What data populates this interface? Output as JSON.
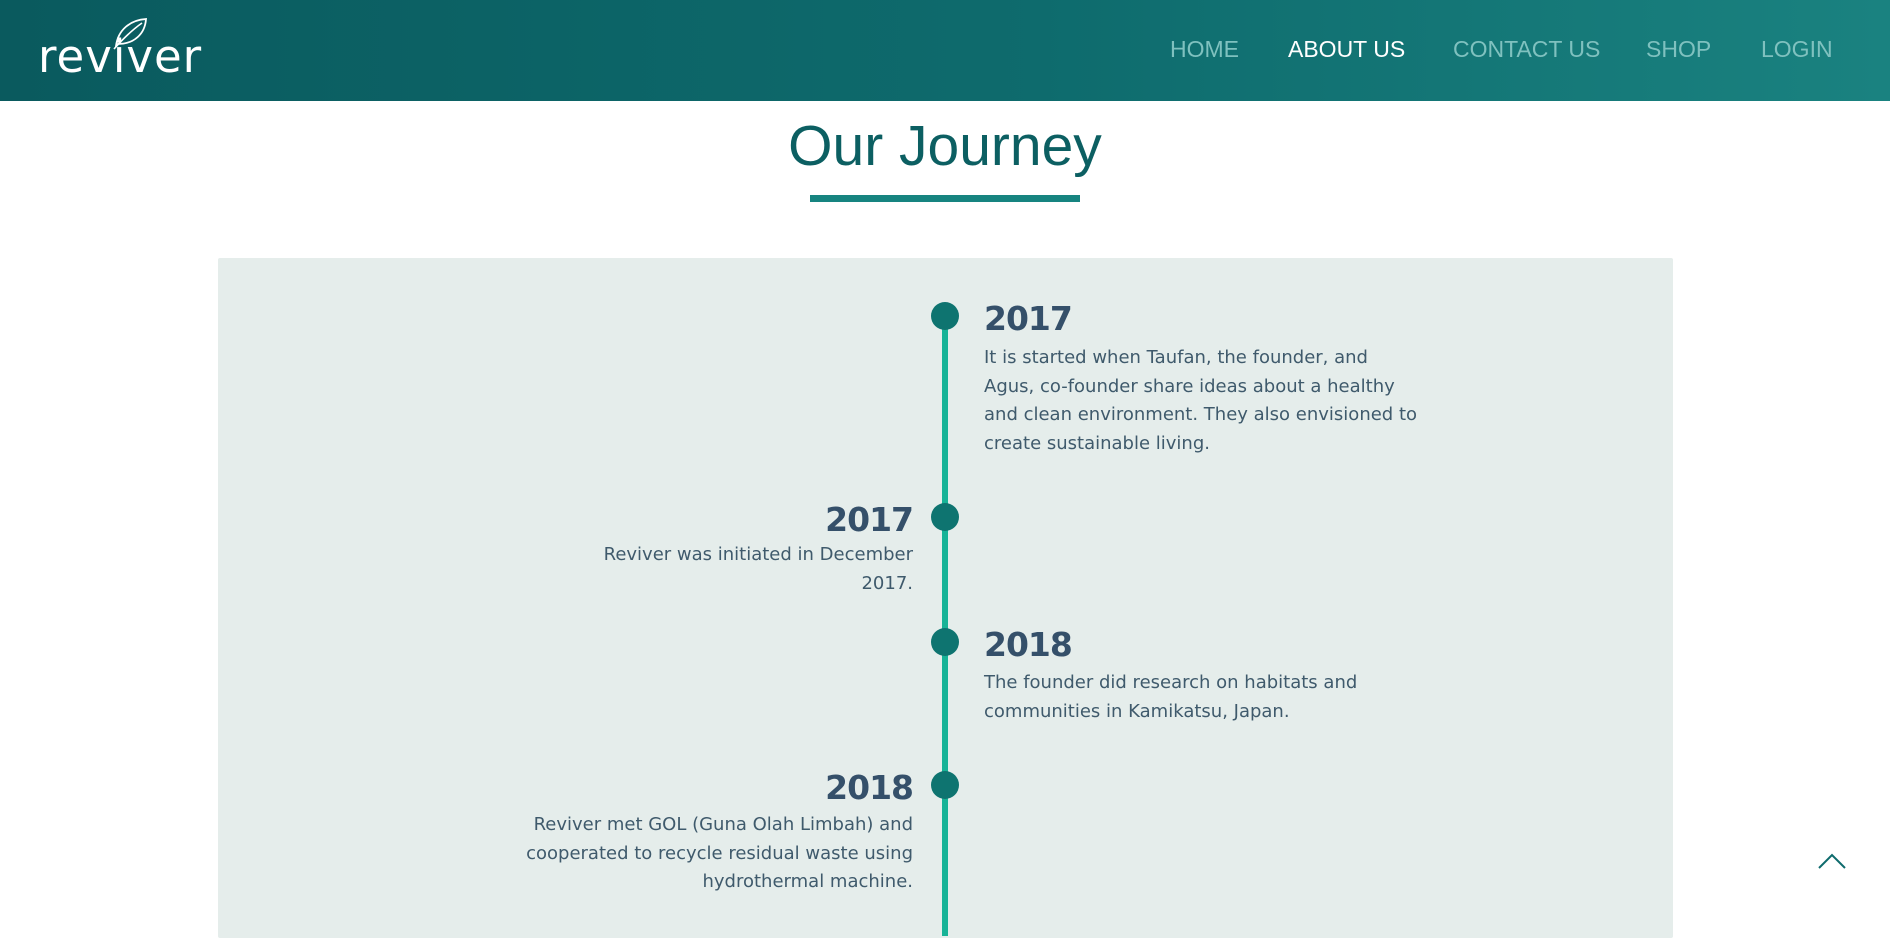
{
  "header": {
    "logo_text": "reviver",
    "nav": [
      {
        "label": "HOME",
        "active": false
      },
      {
        "label": "ABOUT US",
        "active": true
      },
      {
        "label": "CONTACT US",
        "active": false
      },
      {
        "label": "SHOP",
        "active": false
      },
      {
        "label": "LOGIN",
        "active": false
      }
    ]
  },
  "section": {
    "title": "Our Journey"
  },
  "timeline": [
    {
      "year": "2017",
      "side": "right",
      "text_lines": [
        "It is started when Taufan, the founder, and",
        "Agus, co-founder share ideas about a healthy",
        "and clean environment. They also envisioned to",
        "create sustainable living."
      ]
    },
    {
      "year": "2017",
      "side": "left",
      "text_lines": [
        "Reviver was initiated in December",
        "2017."
      ]
    },
    {
      "year": "2018",
      "side": "right",
      "text_lines": [
        "The founder did research on habitats and",
        "communities in Kamikatsu, Japan."
      ]
    },
    {
      "year": "2018",
      "side": "left",
      "text_lines": [
        "Reviver met GOL (Guna Olah Limbah) and",
        "cooperated to recycle residual waste using",
        "hydrothermal machine."
      ]
    }
  ],
  "icons": {
    "logo": "leaf-icon",
    "scroll_top": "chevron-up-icon"
  },
  "colors": {
    "nav_start": "#0a5a5e",
    "nav_end": "#1a8280",
    "title": "#0c5f62",
    "underline": "#168480",
    "panel": "#e5edeb",
    "timeline_line": "#17b397",
    "dot": "#0e7470",
    "year": "#35506a",
    "body_text": "#3f5a6c"
  }
}
